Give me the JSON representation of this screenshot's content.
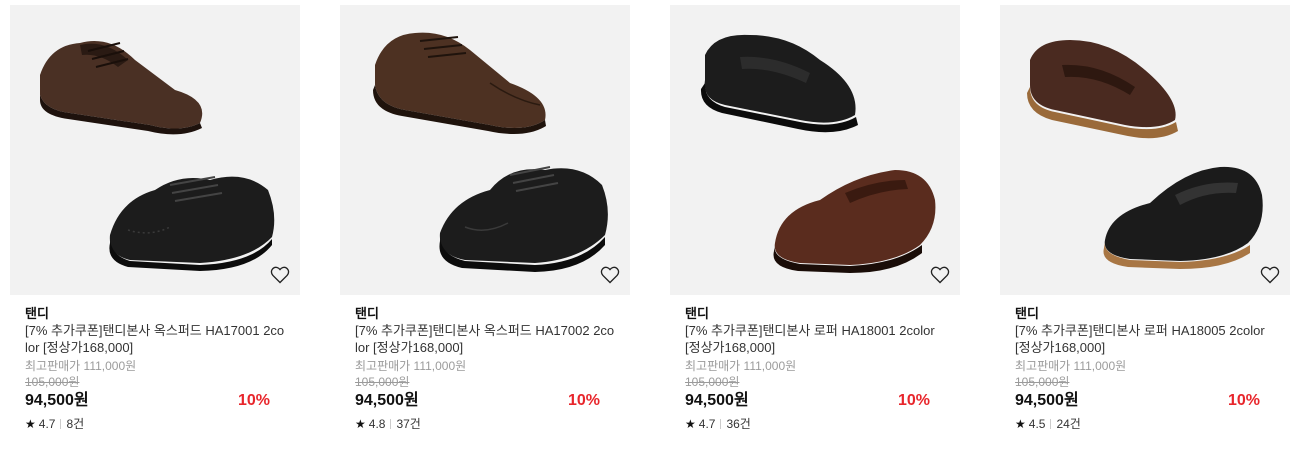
{
  "products": [
    {
      "brand": "탠디",
      "title": "[7% 추가쿠폰]탠디본사 옥스퍼드 HA17001 2color [정상가168,000]",
      "best_price": "최고판매가 111,000원",
      "original_price": "105,000원",
      "price": "94,500원",
      "discount": "10%",
      "rating": "4.7",
      "reviews": "8건",
      "image": "oxford-brown-black-pair"
    },
    {
      "brand": "탠디",
      "title": "[7% 추가쿠폰]탠디본사 옥스퍼드 HA17002 2color [정상가168,000]",
      "best_price": "최고판매가 111,000원",
      "original_price": "105,000원",
      "price": "94,500원",
      "discount": "10%",
      "rating": "4.8",
      "reviews": "37건",
      "image": "derby-brown-black-pair"
    },
    {
      "brand": "탠디",
      "title": "[7% 추가쿠폰]탠디본사 로퍼 HA18001 2color [정상가168,000]",
      "best_price": "최고판매가 111,000원",
      "original_price": "105,000원",
      "price": "94,500원",
      "discount": "10%",
      "rating": "4.7",
      "reviews": "36건",
      "image": "loafer-black-brown-pair"
    },
    {
      "brand": "탠디",
      "title": "[7% 추가쿠폰]탠디본사 로퍼 HA18005 2color [정상가168,000]",
      "best_price": "최고판매가 111,000원",
      "original_price": "105,000원",
      "price": "94,500원",
      "discount": "10%",
      "rating": "4.5",
      "reviews": "24건",
      "image": "penny-loafer-brown-black-pair"
    }
  ],
  "colors": {
    "discount": "#e8262c",
    "thumb_bg": "#f2f2f2",
    "muted": "#9b9b9b",
    "brown_shoe": "#4a3024",
    "black_shoe": "#1c1c1c"
  },
  "icons": {
    "wishlist": "heart-outline-icon",
    "rating": "star-icon"
  }
}
